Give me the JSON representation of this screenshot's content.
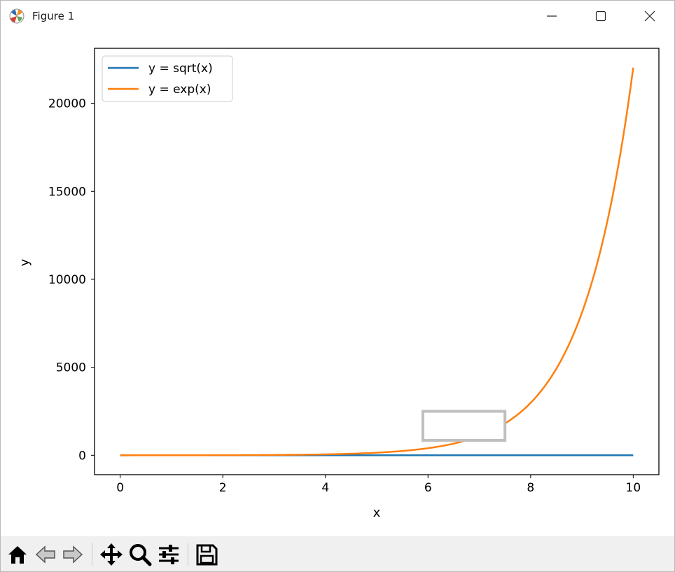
{
  "window": {
    "title": "Figure 1",
    "controls": [
      "minimize",
      "maximize",
      "close"
    ]
  },
  "toolbar": {
    "buttons": [
      {
        "name": "home",
        "icon": "home-icon"
      },
      {
        "name": "back",
        "icon": "arrow-left-icon"
      },
      {
        "name": "forward",
        "icon": "arrow-right-icon"
      },
      {
        "name": "pan",
        "icon": "move-icon"
      },
      {
        "name": "zoom",
        "icon": "magnifier-icon"
      },
      {
        "name": "configure-subplots",
        "icon": "sliders-icon"
      },
      {
        "name": "save",
        "icon": "floppy-disk-icon"
      }
    ]
  },
  "chart_data": {
    "type": "line",
    "title": "",
    "xlabel": "x",
    "ylabel": "y",
    "xlim": [
      -0.5,
      10.5
    ],
    "ylim": [
      -1101,
      23127
    ],
    "xticks": [
      0,
      2,
      4,
      6,
      8,
      10
    ],
    "xtick_labels": [
      "0",
      "2",
      "4",
      "6",
      "8",
      "10"
    ],
    "yticks": [
      0,
      5000,
      10000,
      15000,
      20000
    ],
    "ytick_labels": [
      "0",
      "5000",
      "10000",
      "15000",
      "20000"
    ],
    "grid": false,
    "legend": "upper-left",
    "series": [
      {
        "name": "y = sqrt(x)",
        "function": "sqrt",
        "color": "#1f77b4"
      },
      {
        "name": "y = exp(x)",
        "function": "exp",
        "color": "#ff7f0e"
      }
    ],
    "x_range": [
      0,
      10
    ],
    "zoom_rectangle": {
      "x": [
        5.9,
        7.5
      ],
      "y": [
        850,
        2500
      ],
      "color": "#bfbfbf"
    }
  }
}
